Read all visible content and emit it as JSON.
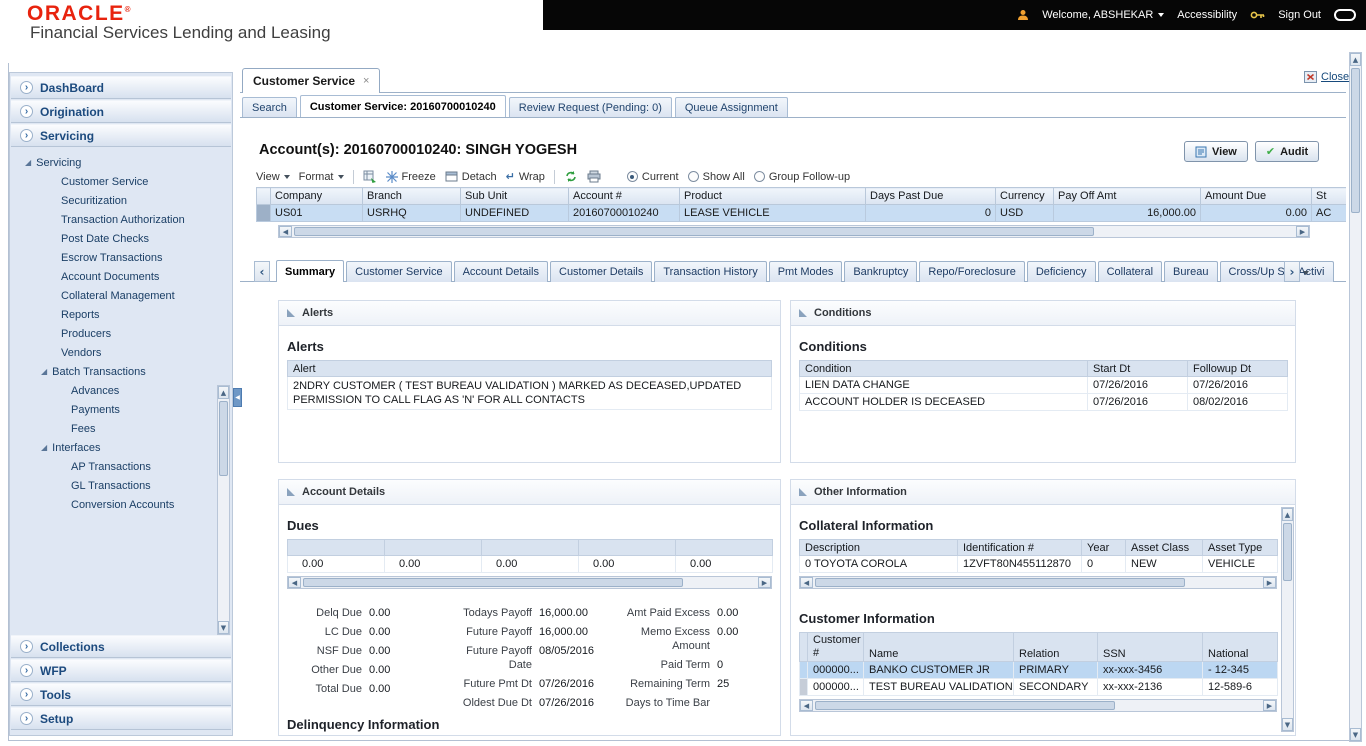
{
  "header": {
    "logo": "ORACLE",
    "subtitle": "Financial Services Lending and Leasing",
    "welcome": "Welcome, ABSHEKAR",
    "accessibility": "Accessibility",
    "sign_out": "Sign Out"
  },
  "sidebar": {
    "sections": [
      {
        "label": "DashBoard"
      },
      {
        "label": "Origination"
      },
      {
        "label": "Servicing"
      },
      {
        "label": "Collections"
      },
      {
        "label": "WFP"
      },
      {
        "label": "Tools"
      },
      {
        "label": "Setup"
      }
    ],
    "tree": {
      "root": "Servicing",
      "items": [
        "Customer Service",
        "Securitization",
        "Transaction Authorization",
        "Post Date Checks",
        "Escrow Transactions",
        "Account Documents",
        "Collateral Management",
        "Reports",
        "Producers",
        "Vendors"
      ],
      "batch_label": "Batch Transactions",
      "batch_items": [
        "Advances",
        "Payments",
        "Fees"
      ],
      "interfaces_label": "Interfaces",
      "interfaces_items": [
        "AP Transactions",
        "GL Transactions",
        "Conversion Accounts"
      ]
    }
  },
  "workspace": {
    "tab_label": "Customer Service",
    "close_label": "Close",
    "subtabs": [
      "Search",
      "Customer Service: 20160700010240",
      "Review Request (Pending: 0)",
      "Queue Assignment"
    ]
  },
  "account": {
    "title": "Account(s): 20160700010240: SINGH YOGESH",
    "view_button": "View",
    "audit_button": "Audit"
  },
  "toolbar": {
    "view": "View",
    "format": "Format",
    "freeze": "Freeze",
    "detach": "Detach",
    "wrap": "Wrap",
    "radio_current": "Current",
    "radio_show_all": "Show All",
    "radio_group_followup": "Group Follow-up"
  },
  "grid": {
    "columns": [
      "Company",
      "Branch",
      "Sub Unit",
      "Account #",
      "Product",
      "Days Past Due",
      "Currency",
      "Pay Off Amt",
      "Amount Due",
      "St"
    ],
    "row": {
      "company": "US01",
      "branch": "USRHQ",
      "sub_unit": "UNDEFINED",
      "account": "20160700010240",
      "product": "LEASE VEHICLE",
      "days_past_due": "0",
      "currency": "USD",
      "pay_off_amt": "16,000.00",
      "amount_due": "0.00",
      "status": "AC"
    }
  },
  "tabstrip": [
    "Summary",
    "Customer Service",
    "Account Details",
    "Customer Details",
    "Transaction History",
    "Pmt Modes",
    "Bankruptcy",
    "Repo/Foreclosure",
    "Deficiency",
    "Collateral",
    "Bureau",
    "Cross/Up Sell Activi"
  ],
  "alerts": {
    "panel_title": "Alerts",
    "section_title": "Alerts",
    "col_alert": "Alert",
    "row_text": "2NDRY CUSTOMER ( TEST BUREAU VALIDATION ) MARKED AS DECEASED,UPDATED PERMISSION TO CALL FLAG AS 'N' FOR ALL CONTACTS"
  },
  "conditions": {
    "panel_title": "Conditions",
    "section_title": "Conditions",
    "columns": [
      "Condition",
      "Start Dt",
      "Followup Dt"
    ],
    "rows": [
      {
        "condition": "LIEN DATA CHANGE",
        "start_dt": "07/26/2016",
        "followup_dt": "07/26/2016"
      },
      {
        "condition": "ACCOUNT HOLDER IS DECEASED",
        "start_dt": "07/26/2016",
        "followup_dt": "08/02/2016"
      }
    ]
  },
  "account_details": {
    "panel_title": "Account Details",
    "dues_title": "Dues",
    "dues_values": [
      "0.00",
      "0.00",
      "0.00",
      "0.00",
      "0.00"
    ],
    "col1": [
      {
        "label": "Delq Due",
        "value": "0.00"
      },
      {
        "label": "LC Due",
        "value": "0.00"
      },
      {
        "label": "NSF Due",
        "value": "0.00"
      },
      {
        "label": "Other Due",
        "value": "0.00"
      },
      {
        "label": "Total Due",
        "value": "0.00"
      }
    ],
    "col2": [
      {
        "label": "Todays Payoff",
        "value": "16,000.00"
      },
      {
        "label": "Future Payoff",
        "value": "16,000.00"
      },
      {
        "label": "Future Payoff Date",
        "value": "08/05/2016"
      },
      {
        "label": "Future Pmt Dt",
        "value": "07/26/2016"
      },
      {
        "label": "Oldest Due Dt",
        "value": "07/26/2016"
      }
    ],
    "col3": [
      {
        "label": "Amt Paid Excess",
        "value": "0.00"
      },
      {
        "label": "Memo Excess Amount",
        "value": "0.00"
      },
      {
        "label": "Paid Term",
        "value": "0"
      },
      {
        "label": "Remaining Term",
        "value": "25"
      },
      {
        "label": "Days to Time Bar",
        "value": ""
      }
    ],
    "delinquency_title": "Delinquency Information"
  },
  "other_info": {
    "panel_title": "Other Information",
    "collateral_title": "Collateral Information",
    "collateral_columns": [
      "Description",
      "Identification #",
      "Year",
      "Asset Class",
      "Asset Type"
    ],
    "collateral_row": {
      "description": "0 TOYOTA COROLA",
      "identification": "1ZVFT80N455112870",
      "year": "0",
      "asset_class": "NEW",
      "asset_type": "VEHICLE"
    },
    "customer_title": "Customer Information",
    "customer_columns": [
      "Customer #",
      "Name",
      "Relation",
      "SSN",
      "National"
    ],
    "customer_rows": [
      {
        "customer_no": "000000...",
        "name": "BANKO CUSTOMER JR",
        "relation": "PRIMARY",
        "ssn": "xx-xxx-3456",
        "national": "- 12-345"
      },
      {
        "customer_no": "000000...",
        "name": "TEST BUREAU VALIDATION",
        "relation": "SECONDARY",
        "ssn": "xx-xxx-2136",
        "national": "12-589-6"
      }
    ]
  }
}
